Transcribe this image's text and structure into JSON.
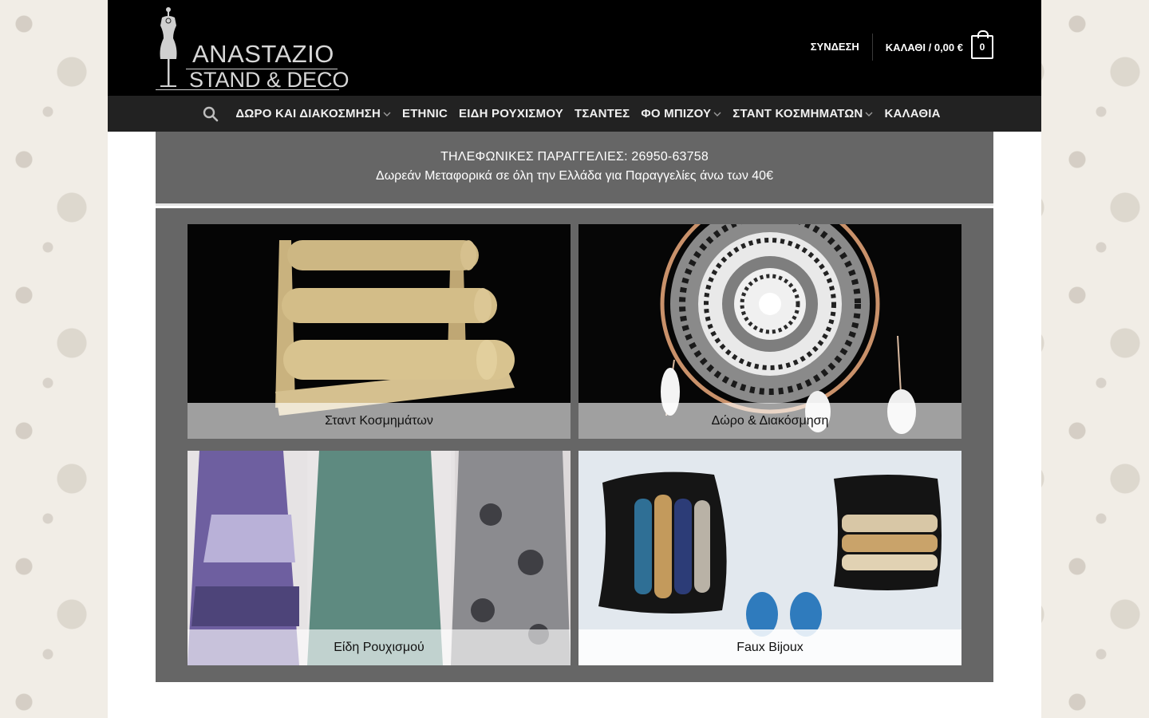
{
  "brand": {
    "name_line1": "ANASTAZIO",
    "name_line2": "STAND & DECO"
  },
  "header": {
    "login_label": "ΣΥΝΔΕΣΗ",
    "cart_label": "ΚΑΛΑΘΙ / 0,00 €",
    "cart_count": "0"
  },
  "nav": {
    "items": [
      {
        "label": "ΔΩΡΟ ΚΑΙ ΔΙΑΚΟΣΜΗΣΗ",
        "has_dropdown": true
      },
      {
        "label": "ETHNIC",
        "has_dropdown": false
      },
      {
        "label": "ΕΙΔΗ ΡΟΥΧΙΣΜΟΥ",
        "has_dropdown": false
      },
      {
        "label": "ΤΣΑΝΤΕΣ",
        "has_dropdown": false
      },
      {
        "label": "ΦΟ ΜΠΙΖΟΥ",
        "has_dropdown": true
      },
      {
        "label": "ΣΤΑΝΤ ΚΟΣΜΗΜΑΤΩΝ",
        "has_dropdown": true
      },
      {
        "label": "ΚΑΛΑΘΙΑ",
        "has_dropdown": false
      }
    ]
  },
  "notice": {
    "line1": "ΤΗΛΕΦΩΝΙΚΕΣ ΠΑΡΑΓΓΕΛΙΕΣ: 26950-63758",
    "line2": "Δωρεάν Μεταφορικά σε όλη την Ελλάδα για Παραγγελίες άνω των 40€"
  },
  "categories": [
    {
      "caption": "Σταντ Κοσμημάτων"
    },
    {
      "caption": "Δώρο & Διακόσμηση"
    },
    {
      "caption": "Είδη Ρουχισμού"
    },
    {
      "caption": "Faux Bijoux"
    }
  ],
  "colors": {
    "header_bg": "#000000",
    "nav_bg": "#222222",
    "panel_bg": "#666666"
  }
}
